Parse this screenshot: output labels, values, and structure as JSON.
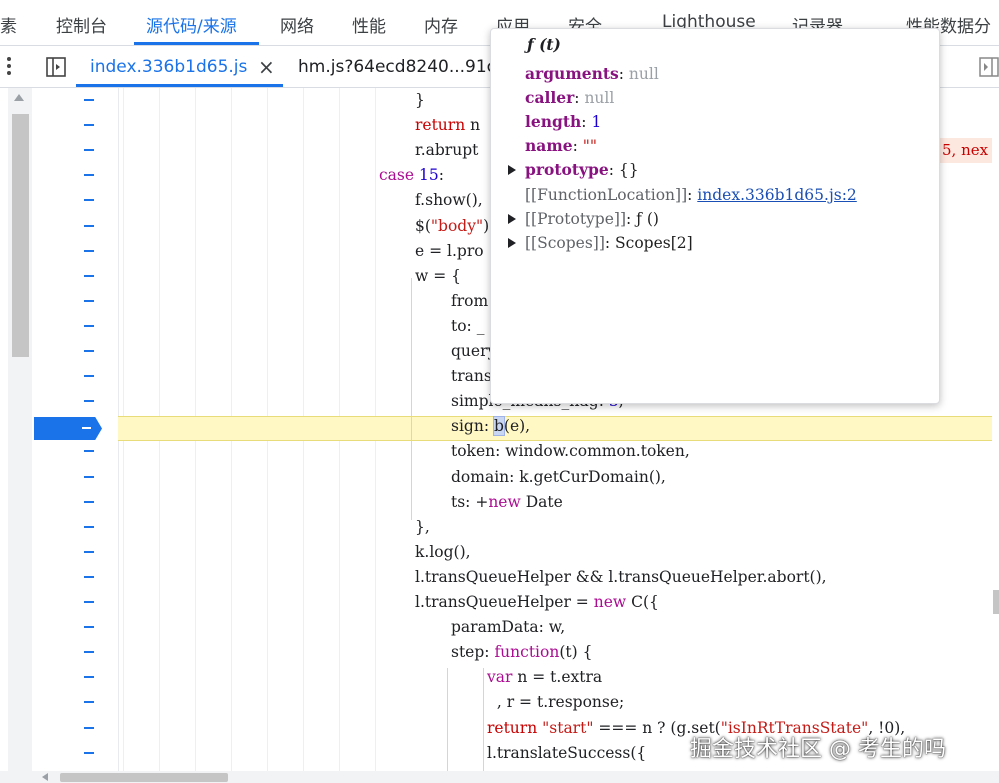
{
  "panel_tabs": [
    {
      "label": "素",
      "active": false
    },
    {
      "label": "控制台",
      "active": false
    },
    {
      "label": "源代码/来源",
      "active": true
    },
    {
      "label": "网络",
      "active": false
    },
    {
      "label": "性能",
      "active": false
    },
    {
      "label": "内存",
      "active": false
    },
    {
      "label": "应用",
      "active": false
    },
    {
      "label": "安全",
      "active": false
    },
    {
      "label": "Lighthouse",
      "active": false
    },
    {
      "label": "记录器",
      "active": false
    },
    {
      "label": "性能数据分",
      "active": false
    }
  ],
  "file_tabs": [
    {
      "label": "index.336b1d65.js",
      "active": true
    },
    {
      "label": "hm.js?64ecd8240...91c",
      "active": false
    }
  ],
  "file_close": "×",
  "code": {
    "right_overflow_text": "5, nex",
    "lines": [
      {
        "indent": 415,
        "segments": [
          {
            "t": "}",
            "c": ""
          }
        ]
      },
      {
        "indent": 415,
        "segments": [
          {
            "t": "return",
            "c": "kw"
          },
          {
            "t": " n",
            "c": ""
          }
        ]
      },
      {
        "indent": 415,
        "segments": [
          {
            "t": "r.abrupt",
            "c": ""
          }
        ]
      },
      {
        "indent": 379,
        "segments": [
          {
            "t": "case",
            "c": "kw2"
          },
          {
            "t": " ",
            "c": ""
          },
          {
            "t": "15",
            "c": "num"
          },
          {
            "t": ":",
            "c": ""
          }
        ]
      },
      {
        "indent": 415,
        "segments": [
          {
            "t": "f.show(),",
            "c": ""
          }
        ]
      },
      {
        "indent": 415,
        "segments": [
          {
            "t": "$(",
            "c": ""
          },
          {
            "t": "\"body\"",
            "c": "str"
          },
          {
            "t": ")",
            "c": ""
          }
        ]
      },
      {
        "indent": 415,
        "segments": [
          {
            "t": "e = l.pro",
            "c": ""
          }
        ]
      },
      {
        "indent": 415,
        "segments": [
          {
            "t": "w = {",
            "c": ""
          }
        ]
      },
      {
        "indent": 451,
        "segments": [
          {
            "t": "from",
            "c": ""
          }
        ]
      },
      {
        "indent": 451,
        "segments": [
          {
            "t": "to: _",
            "c": ""
          }
        ]
      },
      {
        "indent": 451,
        "segments": [
          {
            "t": "query",
            "c": ""
          }
        ]
      },
      {
        "indent": 451,
        "segments": [
          {
            "t": "trans",
            "c": ""
          }
        ]
      },
      {
        "indent": 451,
        "segments": [
          {
            "t": "simple_means_flag: ",
            "c": ""
          },
          {
            "t": "3",
            "c": "num"
          },
          {
            "t": ",",
            "c": ""
          }
        ]
      },
      {
        "indent": 451,
        "segments": [
          {
            "t": "sign: ",
            "c": ""
          },
          {
            "t": "b",
            "c": "hl-var"
          },
          {
            "t": "(e),",
            "c": ""
          }
        ]
      },
      {
        "indent": 451,
        "segments": [
          {
            "t": "token: window.common.token,",
            "c": ""
          }
        ]
      },
      {
        "indent": 451,
        "segments": [
          {
            "t": "domain: k.getCurDomain(),",
            "c": ""
          }
        ]
      },
      {
        "indent": 451,
        "segments": [
          {
            "t": "ts: +",
            "c": ""
          },
          {
            "t": "new",
            "c": "kw2"
          },
          {
            "t": " Date",
            "c": ""
          }
        ]
      },
      {
        "indent": 415,
        "segments": [
          {
            "t": "},",
            "c": ""
          }
        ]
      },
      {
        "indent": 415,
        "segments": [
          {
            "t": "k.log(),",
            "c": ""
          }
        ]
      },
      {
        "indent": 415,
        "segments": [
          {
            "t": "l.transQueueHelper && l.transQueueHelper.abort(),",
            "c": ""
          }
        ]
      },
      {
        "indent": 415,
        "segments": [
          {
            "t": "l.transQueueHelper = ",
            "c": ""
          },
          {
            "t": "new",
            "c": "kw2"
          },
          {
            "t": " C({",
            "c": ""
          }
        ]
      },
      {
        "indent": 451,
        "segments": [
          {
            "t": "paramData: w,",
            "c": ""
          }
        ]
      },
      {
        "indent": 451,
        "segments": [
          {
            "t": "step: ",
            "c": ""
          },
          {
            "t": "function",
            "c": "kw2"
          },
          {
            "t": "(t) {",
            "c": ""
          }
        ]
      },
      {
        "indent": 487,
        "segments": [
          {
            "t": "var",
            "c": "kw2"
          },
          {
            "t": " n = t.extra",
            "c": ""
          }
        ]
      },
      {
        "indent": 487,
        "segments": [
          {
            "t": "  , r = t.response;",
            "c": ""
          }
        ]
      },
      {
        "indent": 487,
        "segments": [
          {
            "t": "return",
            "c": "kw"
          },
          {
            "t": " ",
            "c": ""
          },
          {
            "t": "\"start\"",
            "c": "str"
          },
          {
            "t": " === n ? (g.set(",
            "c": ""
          },
          {
            "t": "\"isInRtTransState\"",
            "c": "str"
          },
          {
            "t": ", !0),",
            "c": ""
          }
        ]
      },
      {
        "indent": 487,
        "segments": [
          {
            "t": "l.translateSuccess({",
            "c": ""
          }
        ]
      }
    ]
  },
  "popover": {
    "title": "ƒ (t)",
    "rows": [
      {
        "key": "arguments",
        "sep": ": ",
        "value": "null",
        "vclass": "pop-null",
        "expandable": false,
        "dim": false
      },
      {
        "key": "caller",
        "sep": ": ",
        "value": "null",
        "vclass": "pop-null",
        "expandable": false,
        "dim": false
      },
      {
        "key": "length",
        "sep": ": ",
        "value": "1",
        "vclass": "pop-num",
        "expandable": false,
        "dim": false
      },
      {
        "key": "name",
        "sep": ": ",
        "value": "\"\"",
        "vclass": "pop-str",
        "expandable": false,
        "dim": false
      },
      {
        "key": "prototype",
        "sep": ": ",
        "value": "{}",
        "vclass": "",
        "expandable": true,
        "dim": false
      },
      {
        "key": "[[FunctionLocation]]",
        "sep": ": ",
        "value": "index.336b1d65.js:2",
        "vclass": "pop-link",
        "expandable": false,
        "dim": true
      },
      {
        "key": "[[Prototype]]",
        "sep": ": ",
        "value": "ƒ ()",
        "vclass": "",
        "expandable": true,
        "dim": true
      },
      {
        "key": "[[Scopes]]",
        "sep": ": ",
        "value": "Scopes[2]",
        "vclass": "",
        "expandable": true,
        "dim": true
      }
    ]
  },
  "watermark": "掘金技术社区 @ 考生的吗"
}
